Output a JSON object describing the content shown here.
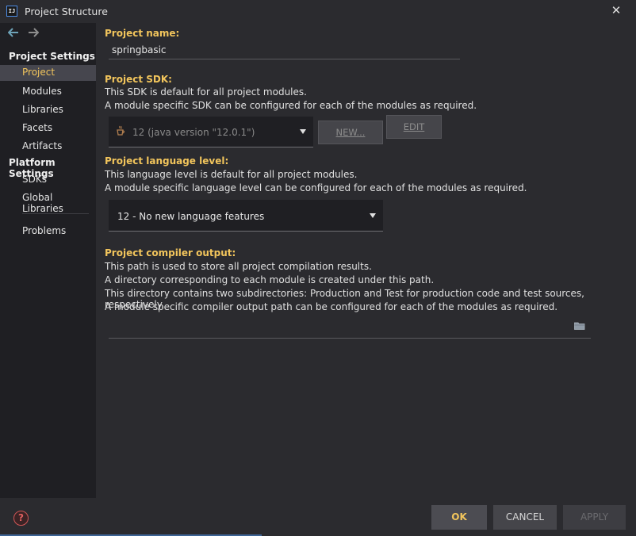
{
  "window": {
    "app_icon_text": "IJ",
    "title": "Project Structure",
    "close_glyph": "✕"
  },
  "nav": {
    "back_glyph": "🡐",
    "forward_glyph": "🡒"
  },
  "sidebar": {
    "project_settings_heading": "Project Settings",
    "project_settings_items": [
      "Project",
      "Modules",
      "Libraries",
      "Facets",
      "Artifacts"
    ],
    "selected_item": "Project",
    "platform_settings_heading": "Platform Settings",
    "platform_settings_items": [
      "SDKs",
      "Global Libraries"
    ],
    "other_items": [
      "Problems"
    ]
  },
  "project_name": {
    "label": "Project name:",
    "value": "springbasic"
  },
  "project_sdk": {
    "label": "Project SDK:",
    "desc_line1": "This SDK is default for all project modules.",
    "desc_line2": "A module specific SDK can be configured for each of the modules as required.",
    "selected": "12 (java version \"12.0.1\")",
    "icon": "java-cup-icon",
    "new_button": "NEW...",
    "edit_button": "EDIT"
  },
  "language_level": {
    "label": "Project language level:",
    "desc_line1": "This language level is default for all project modules.",
    "desc_line2": "A module specific language level can be configured for each of the modules as required.",
    "selected": "12 - No new language features"
  },
  "compiler_output": {
    "label": "Project compiler output:",
    "desc_line1": "This path is used to store all project compilation results.",
    "desc_line2": "A directory corresponding to each module is created under this path.",
    "desc_line3": "This directory contains two subdirectories: Production and Test for production code and test sources, respectively.",
    "desc_line4": "A module specific compiler output path can be configured for each of the modules as required.",
    "value": "",
    "browse_icon": "folder-icon"
  },
  "footer": {
    "help_glyph": "?",
    "ok": "OK",
    "cancel": "CANCEL",
    "apply": "APPLY"
  },
  "colors": {
    "accent": "#f2c55c",
    "background": "#2b2b2f",
    "sidebar": "#1f1f23",
    "selection": "#46464e"
  }
}
